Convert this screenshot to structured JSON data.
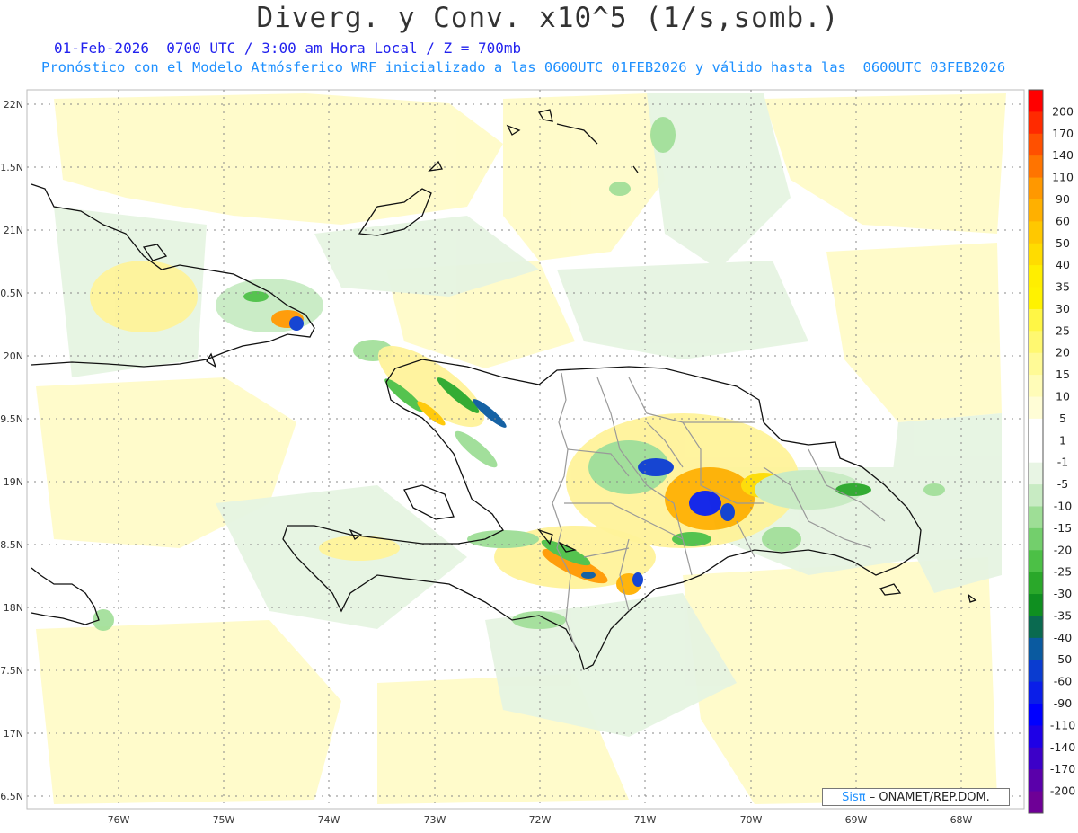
{
  "title": "Diverg. y Conv. x10^5 (1/s,somb.)",
  "subtitle": "01-Feb-2026  0700 UTC / 3:00 am Hora Local / Z = 700mb",
  "subtitle2": "Pronóstico con el Modelo Atmósferico WRF inicializado a las 0600UTC_01FEB2026 y válido hasta las  0600UTC_03FEB2026",
  "lat_labels": [
    "22N",
    "1.5N",
    "21N",
    "0.5N",
    "20N",
    "9.5N",
    "19N",
    "8.5N",
    "18N",
    "7.5N",
    "17N",
    "6.5N"
  ],
  "lon_labels": [
    "76W",
    "75W",
    "74W",
    "73W",
    "72W",
    "71W",
    "70W",
    "69W",
    "68W"
  ],
  "colorbar": {
    "labels": [
      "200",
      "170",
      "140",
      "110",
      "90",
      "60",
      "50",
      "40",
      "35",
      "30",
      "25",
      "20",
      "15",
      "10",
      "5",
      "1",
      "-1",
      "-5",
      "-10",
      "-15",
      "-20",
      "-25",
      "-30",
      "-35",
      "-40",
      "-50",
      "-60",
      "-90",
      "-110",
      "-140",
      "-170",
      "-200"
    ],
    "colors": [
      "#ff0000",
      "#ff2a00",
      "#ff5000",
      "#ff7400",
      "#ff9800",
      "#ffb000",
      "#ffc800",
      "#ffdc00",
      "#ffee00",
      "#fff200",
      "#fff645",
      "#fff870",
      "#fffa96",
      "#fffcb8",
      "#fffdd6",
      "#ffffff",
      "#ffffff",
      "#e8f5e4",
      "#c8ebc3",
      "#9ede96",
      "#73cf6c",
      "#4cc046",
      "#2aa82a",
      "#0f8f20",
      "#0a6a50",
      "#0a5aa0",
      "#0a3cd0",
      "#0a1ee8",
      "#0000ff",
      "#1e00e6",
      "#3c00c8",
      "#5a00aa",
      "#6e0096"
    ]
  },
  "credit": {
    "brand": "Sisπ",
    "text": "– ONAMET/REP.DOM."
  },
  "colors": {
    "background": "#ffffff",
    "land_outline": "#111111",
    "province_outline": "#999999",
    "grid": "#777777"
  }
}
